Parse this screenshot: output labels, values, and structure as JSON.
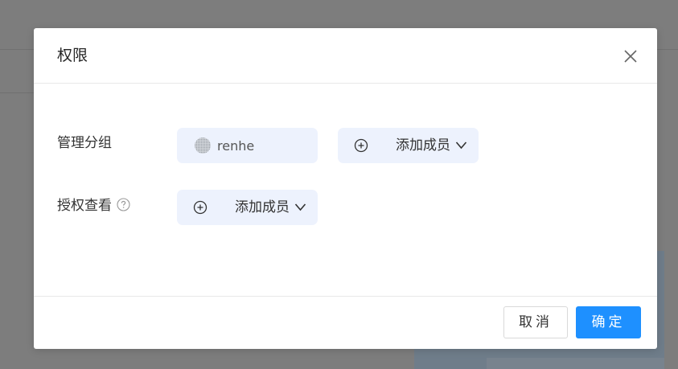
{
  "dialog": {
    "title": "权限",
    "footer": {
      "cancel_label": "取消",
      "confirm_label": "确定"
    }
  },
  "rows": [
    {
      "label": "管理分组",
      "members": [
        {
          "name": "renhe",
          "avatar": "avatar-icon"
        }
      ],
      "add_label": "添加成员"
    },
    {
      "label": "授权查看",
      "members": [],
      "add_label": "添加成员",
      "has_help": true
    }
  ],
  "icons": {
    "close": "close-icon",
    "help": "question-circle-icon",
    "add": "plus-circle-icon",
    "expand": "chevron-down-icon"
  },
  "colors": {
    "primary": "#1e90ff",
    "chip_bg": "#edf2fd"
  }
}
